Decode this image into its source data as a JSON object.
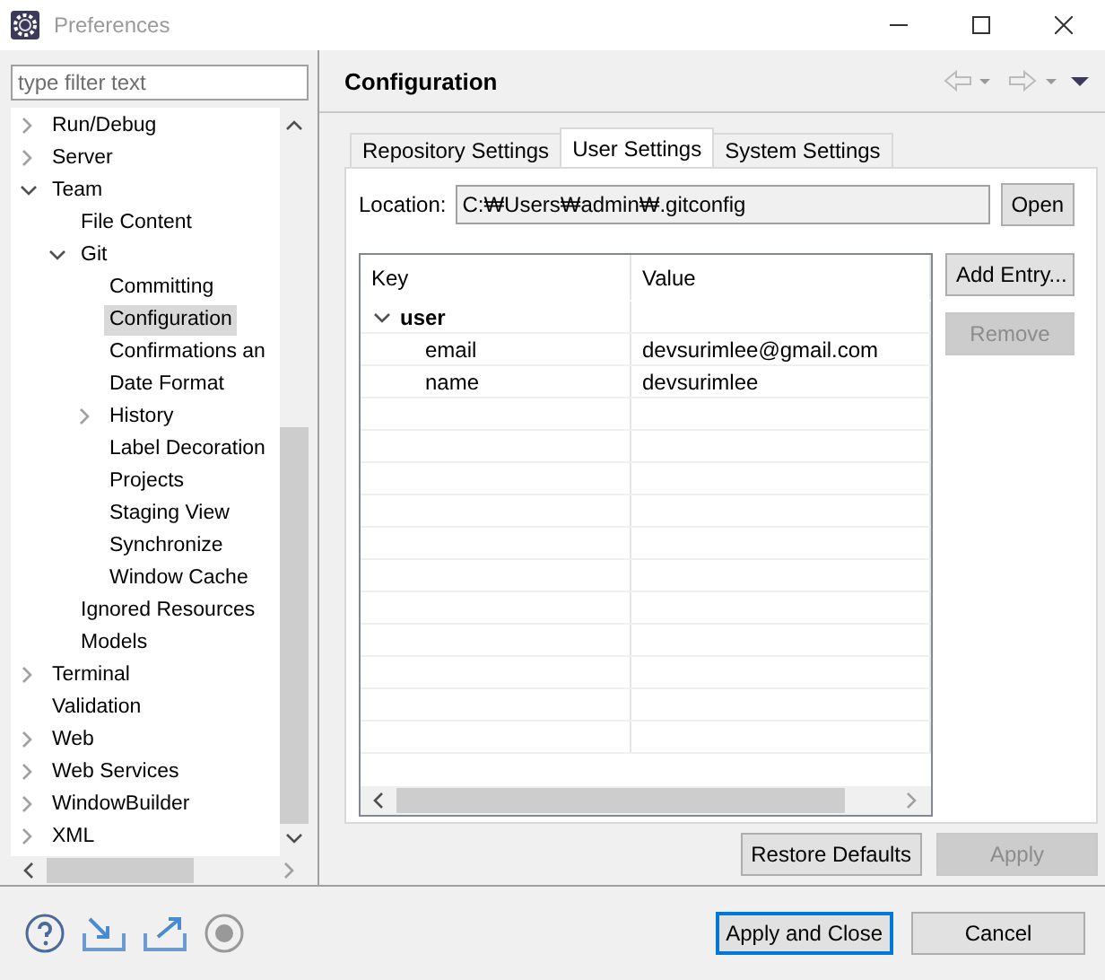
{
  "window": {
    "title": "Preferences"
  },
  "filter": {
    "placeholder": "type filter text"
  },
  "tree": [
    {
      "label": "Run/Debug",
      "expanded": false,
      "selected": false
    },
    {
      "label": "Server",
      "expanded": false,
      "selected": false
    },
    {
      "label": "Team",
      "expanded": true,
      "selected": false,
      "children": [
        {
          "label": "File Content",
          "selected": false
        },
        {
          "label": "Git",
          "expanded": true,
          "selected": false,
          "children": [
            {
              "label": "Committing",
              "selected": false
            },
            {
              "label": "Configuration",
              "selected": true
            },
            {
              "label": "Confirmations an",
              "selected": false
            },
            {
              "label": "Date Format",
              "selected": false
            },
            {
              "label": "History",
              "expanded": false,
              "selected": false
            },
            {
              "label": "Label Decoration",
              "selected": false
            },
            {
              "label": "Projects",
              "selected": false
            },
            {
              "label": "Staging View",
              "selected": false
            },
            {
              "label": "Synchronize",
              "selected": false
            },
            {
              "label": "Window Cache",
              "selected": false
            }
          ]
        },
        {
          "label": "Ignored Resources",
          "selected": false
        },
        {
          "label": "Models",
          "selected": false
        }
      ]
    },
    {
      "label": "Terminal",
      "expanded": false,
      "selected": false
    },
    {
      "label": "Validation",
      "selected": false
    },
    {
      "label": "Web",
      "expanded": false,
      "selected": false
    },
    {
      "label": "Web Services",
      "expanded": false,
      "selected": false
    },
    {
      "label": "WindowBuilder",
      "expanded": false,
      "selected": false
    },
    {
      "label": "XML",
      "expanded": false,
      "selected": false
    }
  ],
  "page": {
    "title": "Configuration"
  },
  "tabs": [
    {
      "label": "Repository Settings",
      "selected": false
    },
    {
      "label": "User Settings",
      "selected": true
    },
    {
      "label": "System Settings",
      "selected": false
    }
  ],
  "location": {
    "label": "Location:",
    "value": "C:₩Users₩admin₩.gitconfig",
    "button": "Open"
  },
  "table": {
    "columns": [
      "Key",
      "Value"
    ],
    "rows": [
      {
        "key": "user",
        "expanded": true,
        "children": [
          {
            "key": "email",
            "value": "devsurimlee@gmail.com"
          },
          {
            "key": "name",
            "value": "devsurimlee"
          }
        ]
      }
    ]
  },
  "side_buttons": [
    {
      "label": "Add Entry...",
      "disabled": false
    },
    {
      "label": "Remove",
      "disabled": true
    }
  ],
  "page_buttons": [
    {
      "label": "Restore Defaults",
      "disabled": false
    },
    {
      "label": "Apply",
      "disabled": true
    }
  ],
  "dialog_buttons": [
    {
      "label": "Apply and Close",
      "default": true
    },
    {
      "label": "Cancel",
      "default": false
    }
  ]
}
